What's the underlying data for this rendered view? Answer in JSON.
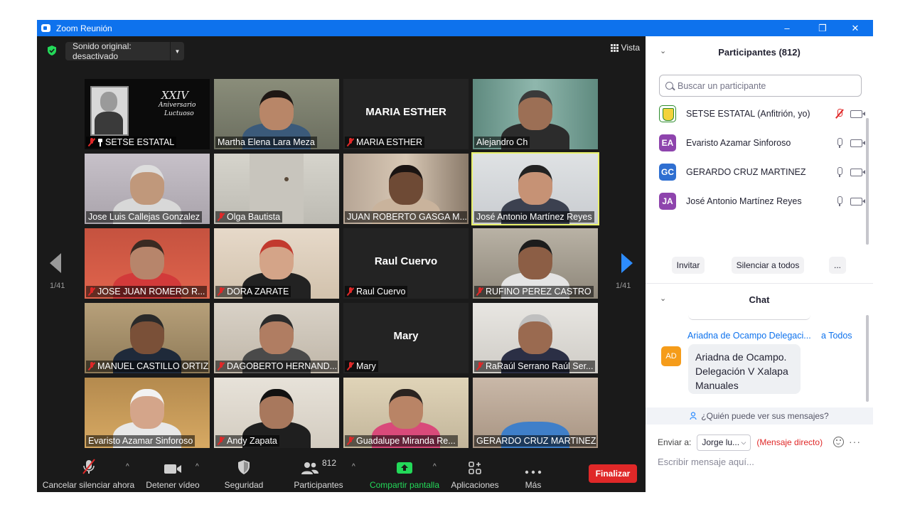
{
  "window": {
    "title": "Zoom Reunión",
    "minimize": "–",
    "maximize": "❐",
    "close": "✕"
  },
  "topbar": {
    "sound_label": "Sonido original: desactivado",
    "sound_dropdown": "▼",
    "view_label": "Vista"
  },
  "pagination": {
    "left": "1/41",
    "right": "1/41"
  },
  "tiles": [
    {
      "name": "SETSE ESTATAL",
      "muted": true,
      "pinned": true,
      "camera": "poster"
    },
    {
      "name": "Martha Elena Lara Meza",
      "muted": false,
      "camera": "video"
    },
    {
      "name": "MARIA ESTHER",
      "muted": true,
      "camera": "off",
      "display_name": "MARIA ESTHER"
    },
    {
      "name": "Alejandro Ch",
      "muted": false,
      "camera": "video"
    },
    {
      "name": "Jose Luis Callejas Gonzalez",
      "muted": false,
      "camera": "video"
    },
    {
      "name": "Olga Bautista",
      "muted": true,
      "camera": "video"
    },
    {
      "name": "JUAN ROBERTO GASGA   M...",
      "muted": false,
      "camera": "video"
    },
    {
      "name": "José Antonio Martínez Reyes",
      "muted": false,
      "camera": "video",
      "talking": true
    },
    {
      "name": "JOSE JUAN ROMERO R...",
      "muted": true,
      "camera": "video"
    },
    {
      "name": "DORA ZARATE",
      "muted": true,
      "camera": "video"
    },
    {
      "name": "Raul Cuervo",
      "muted": true,
      "camera": "off",
      "display_name": "Raul Cuervo"
    },
    {
      "name": "RUFINO PEREZ CASTRO",
      "muted": true,
      "camera": "video"
    },
    {
      "name": "MANUEL CASTILLO ORTIZ",
      "muted": true,
      "camera": "video"
    },
    {
      "name": "DAGOBERTO HERNAND...",
      "muted": true,
      "camera": "video"
    },
    {
      "name": "Mary",
      "muted": true,
      "camera": "off",
      "display_name": "Mary"
    },
    {
      "name": "RaRaúl Serrano Raúl Ser...",
      "muted": true,
      "camera": "video"
    },
    {
      "name": "Evaristo Azamar Sinforoso",
      "muted": false,
      "camera": "video"
    },
    {
      "name": "Andy Zapata",
      "muted": true,
      "camera": "video"
    },
    {
      "name": "Guadalupe Miranda Re...",
      "muted": true,
      "camera": "video"
    },
    {
      "name": "GERARDO CRUZ MARTINEZ",
      "muted": false,
      "camera": "video"
    }
  ],
  "poster": {
    "line1": "XXIV",
    "line2": "Aniversario",
    "line3": "Luctuoso"
  },
  "toolbar": {
    "unmute": "Cancelar silenciar ahora",
    "video": "Detener vídeo",
    "security": "Seguridad",
    "participants": "Participantes",
    "participants_count": "812",
    "share": "Compartir pantalla",
    "apps": "Aplicaciones",
    "more": "Más",
    "end": "Finalizar",
    "caret": "^"
  },
  "participants_panel": {
    "title": "Participantes (812)",
    "collapse_icon": "⌄",
    "search_placeholder": "Buscar un participante",
    "list": [
      {
        "initials": "",
        "name": "SETSE ESTATAL (Anfitrión, yo)",
        "avatar_color": "#ffffff",
        "mic": "muted"
      },
      {
        "initials": "EA",
        "name": "Evaristo Azamar Sinforoso",
        "avatar_color": "#8e44ad",
        "mic": "on"
      },
      {
        "initials": "GC",
        "name": "GERARDO CRUZ MARTINEZ",
        "avatar_color": "#2f6fd1",
        "mic": "on"
      },
      {
        "initials": "JA",
        "name": "José Antonio Martínez Reyes",
        "avatar_color": "#8e44ad",
        "mic": "on"
      }
    ],
    "invite": "Invitar",
    "mute_all": "Silenciar a todos",
    "more": "..."
  },
  "chat": {
    "title": "Chat",
    "sender": "Ariadna de Ocampo Delegaci...",
    "to": "a Todos",
    "avatar_initials": "AD",
    "avatar_color": "#f59c1a",
    "message_lines": [
      "Ariadna de Ocampo.",
      "Delegación V Xalapa",
      "Manuales"
    ],
    "who_can_see": "¿Quién puede ver sus mensajes?",
    "send_to_label": "Enviar a:",
    "send_to_value": "Jorge lu...",
    "direct_message": "(Mensaje directo)",
    "input_placeholder": "Escribir mensaje aquí...",
    "more": "···"
  },
  "colors": {
    "accent": "#0e72ed",
    "end_red": "#e02828",
    "share_green": "#23d959",
    "talking_border": "#e8f06b"
  }
}
